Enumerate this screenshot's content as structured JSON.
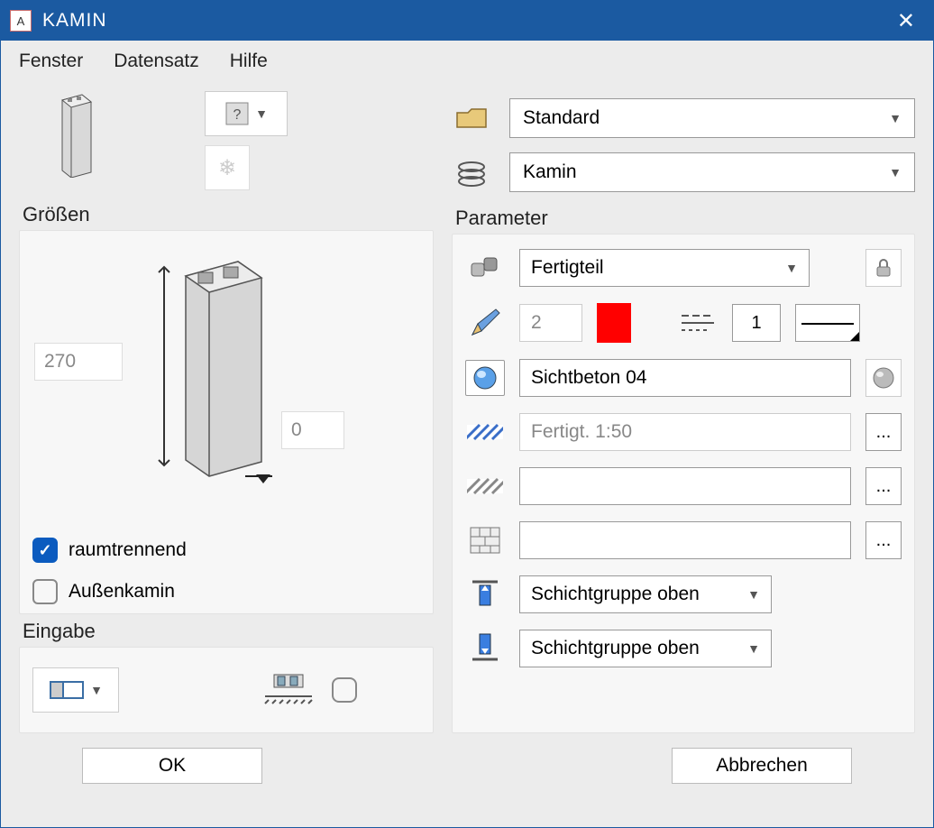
{
  "window": {
    "title": "KAMIN"
  },
  "menu": {
    "fenster": "Fenster",
    "datensatz": "Datensatz",
    "hilfe": "Hilfe"
  },
  "top": {
    "folder_select": "Standard",
    "layer_select": "Kamin"
  },
  "groessen": {
    "label": "Größen",
    "height_value": "270",
    "width_value": "0",
    "raumtrennend_label": "raumtrennend",
    "raumtrennend_checked": true,
    "aussenkamin_label": "Außenkamin",
    "aussenkamin_checked": false
  },
  "eingabe": {
    "label": "Eingabe"
  },
  "parameter": {
    "label": "Parameter",
    "type_select": "Fertigteil",
    "pen_value": "2",
    "pen_color": "#ff0000",
    "line_value": "1",
    "surface_value": "Sichtbeton 04",
    "hatch1_value": "Fertigt. 1:50",
    "hatch2_value": "",
    "pattern_value": "",
    "schicht_top": "Schichtgruppe oben",
    "schicht_bottom": "Schichtgruppe oben",
    "more": "..."
  },
  "footer": {
    "ok": "OK",
    "cancel": "Abbrechen"
  }
}
